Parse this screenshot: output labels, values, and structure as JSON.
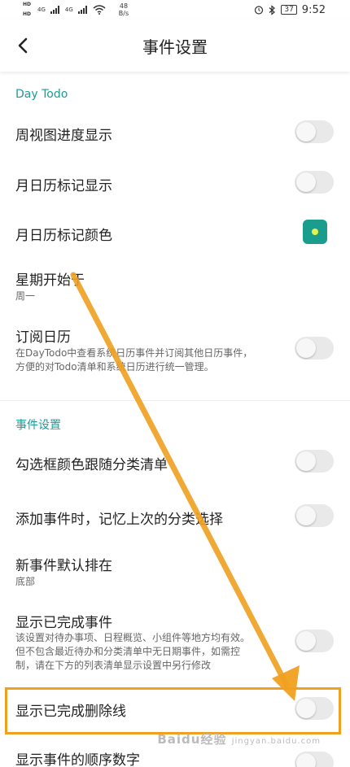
{
  "status_bar": {
    "network_labels": [
      "4G",
      "4G"
    ],
    "hd_labels": [
      "HD",
      "HD"
    ],
    "speed_value": "48",
    "speed_unit": "B/s",
    "battery": "37",
    "time": "9:52"
  },
  "app_bar": {
    "title": "事件设置"
  },
  "sections": [
    {
      "header": "Day Todo"
    },
    {
      "header": "事件设置"
    }
  ],
  "settings": {
    "week_progress": {
      "title": "周视图进度显示"
    },
    "month_marker": {
      "title": "月日历标记显示"
    },
    "month_marker_color": {
      "title": "月日历标记颜色",
      "color": "#1a9d8d"
    },
    "week_start": {
      "title": "星期开始于",
      "value": "周一"
    },
    "subscribe_calendar": {
      "title": "订阅日历",
      "description_line1": "在DayTodo中查看系统日历事件并订阅其他日历事件，",
      "description_line2": "方便的对Todo清单和系统日历进行统一管理。"
    },
    "checkbox_color_follow": {
      "title": "勾选框颜色跟随分类清单"
    },
    "remember_category": {
      "title": "添加事件时，记忆上次的分类选择"
    },
    "new_event_order": {
      "title": "新事件默认排在",
      "value": "底部"
    },
    "show_completed": {
      "title": "显示已完成事件",
      "description_line1": "该设置对待办事项、日程概览、小组件等地方均有效。",
      "description_line2": "但不包含最近待办和分类清单中无日期事件，如需控",
      "description_line3": "制，请在下方的列表清单显示设置中另行修改"
    },
    "show_strikethrough": {
      "title": "显示已完成删除线"
    },
    "show_order_number": {
      "title": "显示事件的顺序数字"
    }
  },
  "annotation": {
    "highlight_color": "#f0a020"
  },
  "watermark": {
    "text": "Baidu经验",
    "sub": "jingyan.baidu.com"
  }
}
